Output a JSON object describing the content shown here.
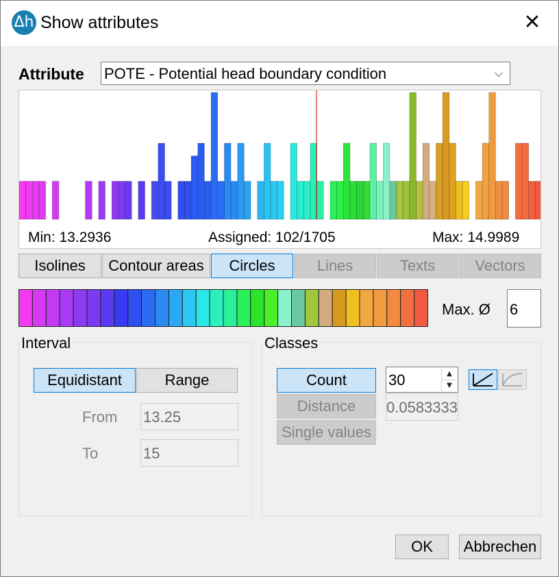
{
  "window": {
    "title": "Show attributes",
    "icon_text": "Δh",
    "close_glyph": "✕"
  },
  "attribute": {
    "label": "Attribute",
    "selected": "POTE - Potential head boundary condition"
  },
  "histogram": {
    "min_text": "Min: 13.2936",
    "assigned_text": "Assigned: 102/1705",
    "max_text": "Max: 14.9989",
    "marker_color": "#cc0000",
    "bins": [
      {
        "h": 3,
        "c": "#f23af0"
      },
      {
        "h": 3,
        "c": "#f23af0"
      },
      {
        "h": 3,
        "c": "#e53af2"
      },
      {
        "h": 3,
        "c": "#e23af2"
      },
      {
        "h": 0,
        "c": ""
      },
      {
        "h": 3,
        "c": "#d53af2"
      },
      {
        "h": 0,
        "c": ""
      },
      {
        "h": 0,
        "c": ""
      },
      {
        "h": 0,
        "c": ""
      },
      {
        "h": 0,
        "c": ""
      },
      {
        "h": 3,
        "c": "#b23af2"
      },
      {
        "h": 0,
        "c": ""
      },
      {
        "h": 3,
        "c": "#9e3af2"
      },
      {
        "h": 0,
        "c": ""
      },
      {
        "h": 3,
        "c": "#8d3af2"
      },
      {
        "h": 3,
        "c": "#7d3af2"
      },
      {
        "h": 3,
        "c": "#6c3af2"
      },
      {
        "h": 0,
        "c": ""
      },
      {
        "h": 3,
        "c": "#5a3af2"
      },
      {
        "h": 0,
        "c": ""
      },
      {
        "h": 3,
        "c": "#4a4af2"
      },
      {
        "h": 6,
        "c": "#3a4ef2"
      },
      {
        "h": 3,
        "c": "#3a4ef2"
      },
      {
        "h": 0,
        "c": ""
      },
      {
        "h": 3,
        "c": "#2f4fef"
      },
      {
        "h": 3,
        "c": "#2f4fef"
      },
      {
        "h": 5,
        "c": "#2a5cf2"
      },
      {
        "h": 6,
        "c": "#2a5cf2"
      },
      {
        "h": 3,
        "c": "#2a5cf2"
      },
      {
        "h": 10,
        "c": "#2a6cf2"
      },
      {
        "h": 3,
        "c": "#2a6cf2"
      },
      {
        "h": 6,
        "c": "#2a8af2"
      },
      {
        "h": 3,
        "c": "#2a8af2"
      },
      {
        "h": 6,
        "c": "#2a9af2"
      },
      {
        "h": 3,
        "c": "#2aa4f2"
      },
      {
        "h": 0,
        "c": ""
      },
      {
        "h": 3,
        "c": "#2ab4f2"
      },
      {
        "h": 6,
        "c": "#2ac4f2"
      },
      {
        "h": 3,
        "c": "#2ac8f2"
      },
      {
        "h": 3,
        "c": "#2ad0f2"
      },
      {
        "h": 0,
        "c": ""
      },
      {
        "h": 6,
        "c": "#2ae8e0"
      },
      {
        "h": 3,
        "c": "#2aecd4"
      },
      {
        "h": 3,
        "c": "#2af0c8"
      },
      {
        "h": 6,
        "c": "#2af0b8"
      },
      {
        "h": 3,
        "c": "#2af0a8"
      },
      {
        "h": 0,
        "c": ""
      },
      {
        "h": 3,
        "c": "#2af05a"
      },
      {
        "h": 3,
        "c": "#2af04a"
      },
      {
        "h": 6,
        "c": "#2ae63a"
      },
      {
        "h": 3,
        "c": "#2ade3a"
      },
      {
        "h": 3,
        "c": "#2ad63a"
      },
      {
        "h": 3,
        "c": "#3ad63a"
      },
      {
        "h": 6,
        "c": "#5af2a0"
      },
      {
        "h": 3,
        "c": "#7af2c0"
      },
      {
        "h": 6,
        "c": "#8af2c8"
      },
      {
        "h": 3,
        "c": "#6ac8a0"
      },
      {
        "h": 3,
        "c": "#a0c83a"
      },
      {
        "h": 3,
        "c": "#9ec33a"
      },
      {
        "h": 10,
        "c": "#8ab82a"
      },
      {
        "h": 3,
        "c": "#b4c040"
      },
      {
        "h": 6,
        "c": "#d4aa80"
      },
      {
        "h": 3,
        "c": "#d8b080"
      },
      {
        "h": 6,
        "c": "#d8a020"
      },
      {
        "h": 10,
        "c": "#d89a20"
      },
      {
        "h": 6,
        "c": "#e0a020"
      },
      {
        "h": 3,
        "c": "#f0c020"
      },
      {
        "h": 3,
        "c": "#f4d020"
      },
      {
        "h": 0,
        "c": ""
      },
      {
        "h": 3,
        "c": "#f2a840"
      },
      {
        "h": 6,
        "c": "#f2a040"
      },
      {
        "h": 10,
        "c": "#f09a40"
      },
      {
        "h": 3,
        "c": "#f09040"
      },
      {
        "h": 3,
        "c": "#f08a40"
      },
      {
        "h": 0,
        "c": ""
      },
      {
        "h": 6,
        "c": "#f27040"
      },
      {
        "h": 6,
        "c": "#f26a40"
      },
      {
        "h": 3,
        "c": "#f06040"
      },
      {
        "h": 3,
        "c": "#f05a40"
      }
    ]
  },
  "tabs": [
    {
      "label": "Isolines",
      "state": "normal"
    },
    {
      "label": "Contour areas",
      "state": "normal"
    },
    {
      "label": "Circles",
      "state": "active"
    },
    {
      "label": "Lines",
      "state": "disabled"
    },
    {
      "label": "Texts",
      "state": "disabled"
    },
    {
      "label": "Vectors",
      "state": "disabled"
    }
  ],
  "ramp_colors": [
    "#f23af0",
    "#d63af2",
    "#c23af2",
    "#a83af2",
    "#8d3af2",
    "#7a3af2",
    "#5a3af2",
    "#3a3af2",
    "#2f4fef",
    "#2a6cf2",
    "#2a8af2",
    "#2aa8f2",
    "#2ac8f2",
    "#2ae8e8",
    "#2af0c0",
    "#2af09a",
    "#2af05a",
    "#2ae62a",
    "#4af02a",
    "#8af2c8",
    "#6ac8a0",
    "#a0c83a",
    "#d4aa80",
    "#d89a20",
    "#f0c020",
    "#f2a840",
    "#f29a40",
    "#f28a40",
    "#f27040",
    "#f05a40"
  ],
  "max_diameter": {
    "label": "Max. Ø",
    "value": "6"
  },
  "interval": {
    "title": "Interval",
    "equidistant_label": "Equidistant",
    "range_label": "Range",
    "from_label": "From",
    "from_value": "13.25",
    "to_label": "To",
    "to_value": "15"
  },
  "classes": {
    "title": "Classes",
    "count_label": "Count",
    "distance_label": "Distance",
    "single_values_label": "Single values",
    "count_value": "30",
    "distance_value": "0.0583333"
  },
  "footer": {
    "ok_label": "OK",
    "cancel_label": "Abbrechen"
  }
}
